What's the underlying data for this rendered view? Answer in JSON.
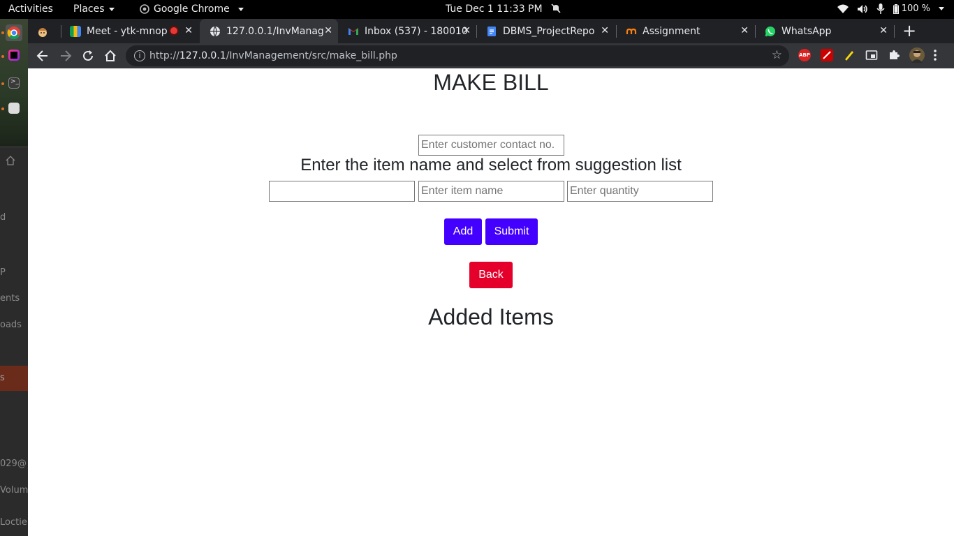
{
  "topbar": {
    "activities": "Activities",
    "places": "Places",
    "app_name": "Google Chrome",
    "clock": "Tue Dec 1  11:33 PM",
    "battery": "100 %"
  },
  "dock": {
    "fragments": [
      "d",
      "P",
      "ents",
      "oads",
      "s",
      "029@",
      "Volum",
      "Loctie"
    ]
  },
  "tabs": [
    {
      "title": "Meet - ytk-mnop",
      "icon": "google-meet-icon"
    },
    {
      "title": "127.0.0.1/InvManag",
      "icon": "globe-icon",
      "active": true
    },
    {
      "title": "Inbox (537) - 180010",
      "icon": "gmail-icon"
    },
    {
      "title": "DBMS_ProjectRepo",
      "icon": "google-docs-icon"
    },
    {
      "title": "Assignment",
      "icon": "moodle-icon"
    },
    {
      "title": "WhatsApp",
      "icon": "whatsapp-icon"
    }
  ],
  "address_bar": {
    "scheme": "http://",
    "host": "127.0.0.1",
    "path": "/InvManagement/src/make_bill.php"
  },
  "extensions": {
    "adblock_label": "ABP"
  },
  "page": {
    "title": "MAKE BILL",
    "contact_placeholder": "Enter customer contact no.",
    "instruction": "Enter the item name and select from suggestion list",
    "item_code_value": "",
    "item_name_placeholder": "Enter item name",
    "quantity_placeholder": "Enter quantity",
    "add_label": "Add",
    "submit_label": "Submit",
    "back_label": "Back",
    "added_items_heading": "Added Items"
  },
  "colors": {
    "primary_button": "#4400ff",
    "back_button": "#e4002b",
    "chrome_frame": "#202124",
    "chrome_toolbar": "#35363a"
  }
}
